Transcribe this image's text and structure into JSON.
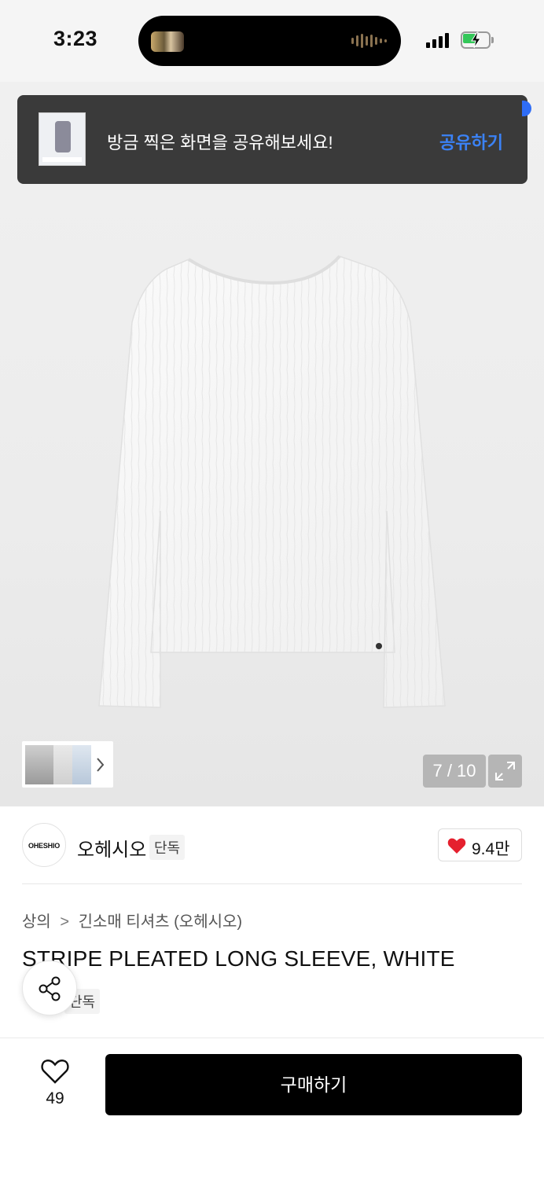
{
  "status_bar": {
    "time": "3:23",
    "battery_color": "#34c759"
  },
  "toast": {
    "message": "방금 찍은 화면을 공유해보세요!",
    "action": "공유하기",
    "action_color": "#3b82f6"
  },
  "gallery": {
    "counter": "7 / 10"
  },
  "brand": {
    "logo_text": "OHESHIO",
    "name": "오헤시오",
    "badge": "단독",
    "likes": "9.4만"
  },
  "product": {
    "breadcrumb": [
      "상의",
      "긴소매 티셔츠 (오헤시오)"
    ],
    "title": "STRIPE PLEATED LONG SLEEVE, WHITE",
    "badge": "단독"
  },
  "bottom_bar": {
    "wish_count": "49",
    "buy_label": "구매하기"
  },
  "icons": [
    "search-icon",
    "heart-icon",
    "share-icon",
    "expand-icon",
    "chevron-right-icon"
  ]
}
